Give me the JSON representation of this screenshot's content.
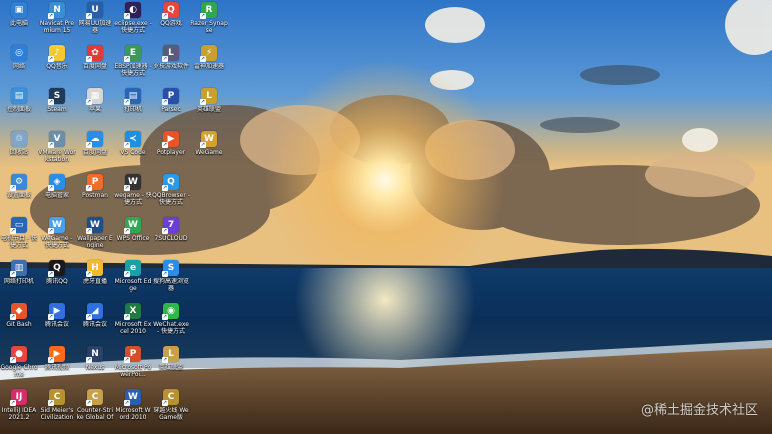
{
  "desktop": {
    "icons": [
      {
        "label": "此电脑",
        "icon": "computer-icon",
        "color": "#2f7fd6",
        "glyph": "▣"
      },
      {
        "label": "网络",
        "icon": "network-icon",
        "color": "#2f7fd6",
        "glyph": "◎"
      },
      {
        "label": "控制面板",
        "icon": "control-panel-icon",
        "color": "#3d8fd8",
        "glyph": "▤"
      },
      {
        "label": "回收站",
        "icon": "recycle-bin-icon",
        "color": "#7fa6c8",
        "glyph": "♲"
      },
      {
        "label": "设置面板",
        "icon": "settings-icon",
        "color": "#3b88d6",
        "glyph": "⚙"
      },
      {
        "label": "电视节目 - 快捷方式",
        "icon": "tv-icon",
        "color": "#2a66b8",
        "glyph": "▭"
      },
      {
        "label": "网络打印机",
        "icon": "printer-icon",
        "color": "#3d6fb0",
        "glyph": "▥"
      },
      {
        "label": "Git Bash",
        "icon": "git-bash-icon",
        "color": "#e5542a",
        "glyph": "◆"
      },
      {
        "label": "Google Chrome",
        "icon": "chrome-icon",
        "color": "#e8453c",
        "glyph": "●"
      },
      {
        "label": "IntelliJ IDEA 2021.2",
        "icon": "intellij-icon",
        "color": "#d62d6a",
        "glyph": "IJ"
      },
      {
        "label": "Navicat Premium 15",
        "icon": "navicat-icon",
        "color": "#3a8fd0",
        "glyph": "N"
      },
      {
        "label": "QQ音乐",
        "icon": "qq-music-icon",
        "color": "#f7c830",
        "glyph": "♪"
      },
      {
        "label": "Steam",
        "icon": "steam-icon",
        "color": "#1f3b5c",
        "glyph": "S"
      },
      {
        "label": "VMware Workstation",
        "icon": "vmware-icon",
        "color": "#6b8fa8",
        "glyph": "V"
      },
      {
        "label": "电脑管家",
        "icon": "pc-manager-icon",
        "color": "#2a8ee8",
        "glyph": "◈"
      },
      {
        "label": "WeGame - 快捷方式",
        "icon": "wegame-icon",
        "color": "#4aa0e8",
        "glyph": "W"
      },
      {
        "label": "腾讯QQ",
        "icon": "qq-icon",
        "color": "#1a1a1a",
        "glyph": "Q"
      },
      {
        "label": "腾讯会议",
        "icon": "tencent-meeting-icon",
        "color": "#2f6fe0",
        "glyph": "▶"
      },
      {
        "label": "腾讯视频",
        "icon": "tencent-video-icon",
        "color": "#ff6a1a",
        "glyph": "▶"
      },
      {
        "label": "Sid Meier's Civilization",
        "icon": "civilization-icon",
        "color": "#b8922e",
        "glyph": "C"
      },
      {
        "label": "网易UU加速器",
        "icon": "uu-accelerator-icon",
        "color": "#2a5fa8",
        "glyph": "U"
      },
      {
        "label": "百度网盘",
        "icon": "baidu-netdisk-icon",
        "color": "#e03a3a",
        "glyph": "✿"
      },
      {
        "label": "苹果",
        "icon": "app-icon",
        "color": "#d6d6d6",
        "glyph": "▦"
      },
      {
        "label": "百度网盘",
        "icon": "cloud-icon",
        "color": "#2a8ee8",
        "glyph": "☁"
      },
      {
        "label": "Postman",
        "icon": "postman-icon",
        "color": "#ef6c2b",
        "glyph": "P"
      },
      {
        "label": "Wallpaper Engine",
        "icon": "wallpaper-engine-icon",
        "color": "#1f4f8a",
        "glyph": "W"
      },
      {
        "label": "虎牙直播",
        "icon": "huya-icon",
        "color": "#f5b82e",
        "glyph": "H"
      },
      {
        "label": "腾讯会议",
        "icon": "tencent-meeting2-icon",
        "color": "#2f6fe0",
        "glyph": "◢"
      },
      {
        "label": "Nexus",
        "icon": "nexus-icon",
        "color": "#2a3f6a",
        "glyph": "N"
      },
      {
        "label": "Counter-Strike Global Offensive",
        "icon": "csgo-icon",
        "color": "#c9a04a",
        "glyph": "C"
      },
      {
        "label": "eclipse.exe - 快捷方式",
        "icon": "eclipse-icon",
        "color": "#2c2255",
        "glyph": "◐"
      },
      {
        "label": "EBSP加速器 - 快捷方式",
        "icon": "ebsp-icon",
        "color": "#3a9a5a",
        "glyph": "E"
      },
      {
        "label": "打印机",
        "icon": "printer2-icon",
        "color": "#2a66b8",
        "glyph": "▤"
      },
      {
        "label": "VS Code",
        "icon": "vscode-icon",
        "color": "#1f8fe0",
        "glyph": "≺"
      },
      {
        "label": "wegame - 快捷方式",
        "icon": "wegame2-icon",
        "color": "#333333",
        "glyph": "W"
      },
      {
        "label": "WPS Office",
        "icon": "wps-icon",
        "color": "#2fa84f",
        "glyph": "W"
      },
      {
        "label": "Microsoft Edge",
        "icon": "edge-icon",
        "color": "#1ba0a8",
        "glyph": "e"
      },
      {
        "label": "Microsoft Excel 2010",
        "icon": "excel-icon",
        "color": "#1f7a3f",
        "glyph": "X"
      },
      {
        "label": "Microsoft PowerPoi...",
        "icon": "powerpoint-icon",
        "color": "#d0502a",
        "glyph": "P"
      },
      {
        "label": "Microsoft Word 2010",
        "icon": "word-icon",
        "color": "#2a5fb0",
        "glyph": "W"
      },
      {
        "label": "QQ游戏",
        "icon": "qq-game-icon",
        "color": "#e8453c",
        "glyph": "Q"
      },
      {
        "label": "罗技游戏软件",
        "icon": "logitech-icon",
        "color": "#5a5a7a",
        "glyph": "L"
      },
      {
        "label": "Parsec",
        "icon": "parsec-icon",
        "color": "#2a4fa8",
        "glyph": "P"
      },
      {
        "label": "Potplayer",
        "icon": "potplayer-icon",
        "color": "#e8542a",
        "glyph": "▶"
      },
      {
        "label": "QQBrowser - 快捷方式",
        "icon": "qq-browser-icon",
        "color": "#2a9ae8",
        "glyph": "Q"
      },
      {
        "label": "7SUCLOUD",
        "icon": "sucloud-icon",
        "color": "#6a3fd8",
        "glyph": "7"
      },
      {
        "label": "搜狗高速浏览器",
        "icon": "sogou-browser-icon",
        "color": "#2a8ee8",
        "glyph": "S"
      },
      {
        "label": "WeChat.exe - 快捷方式",
        "icon": "wechat-icon",
        "color": "#2fb84a",
        "glyph": "◉"
      },
      {
        "label": "英雄联盟",
        "icon": "lol-icon",
        "color": "#c9a04a",
        "glyph": "L"
      },
      {
        "label": "穿越火线 WeGame版",
        "icon": "crossfire-icon",
        "color": "#b8922e",
        "glyph": "C"
      },
      {
        "label": "Razer Synapse",
        "icon": "razer-icon",
        "color": "#2fa84f",
        "glyph": "R"
      },
      {
        "label": "雷神加速器",
        "icon": "thunder-accelerator-icon",
        "color": "#c9a030",
        "glyph": "⚡"
      },
      {
        "label": "英雄联盟",
        "icon": "lol2-icon",
        "color": "#c9a030",
        "glyph": "L"
      },
      {
        "label": "WeGame",
        "icon": "wegame3-icon",
        "color": "#d6a030",
        "glyph": "W"
      }
    ]
  },
  "watermark": {
    "text": "@稀土掘金技术社区"
  }
}
